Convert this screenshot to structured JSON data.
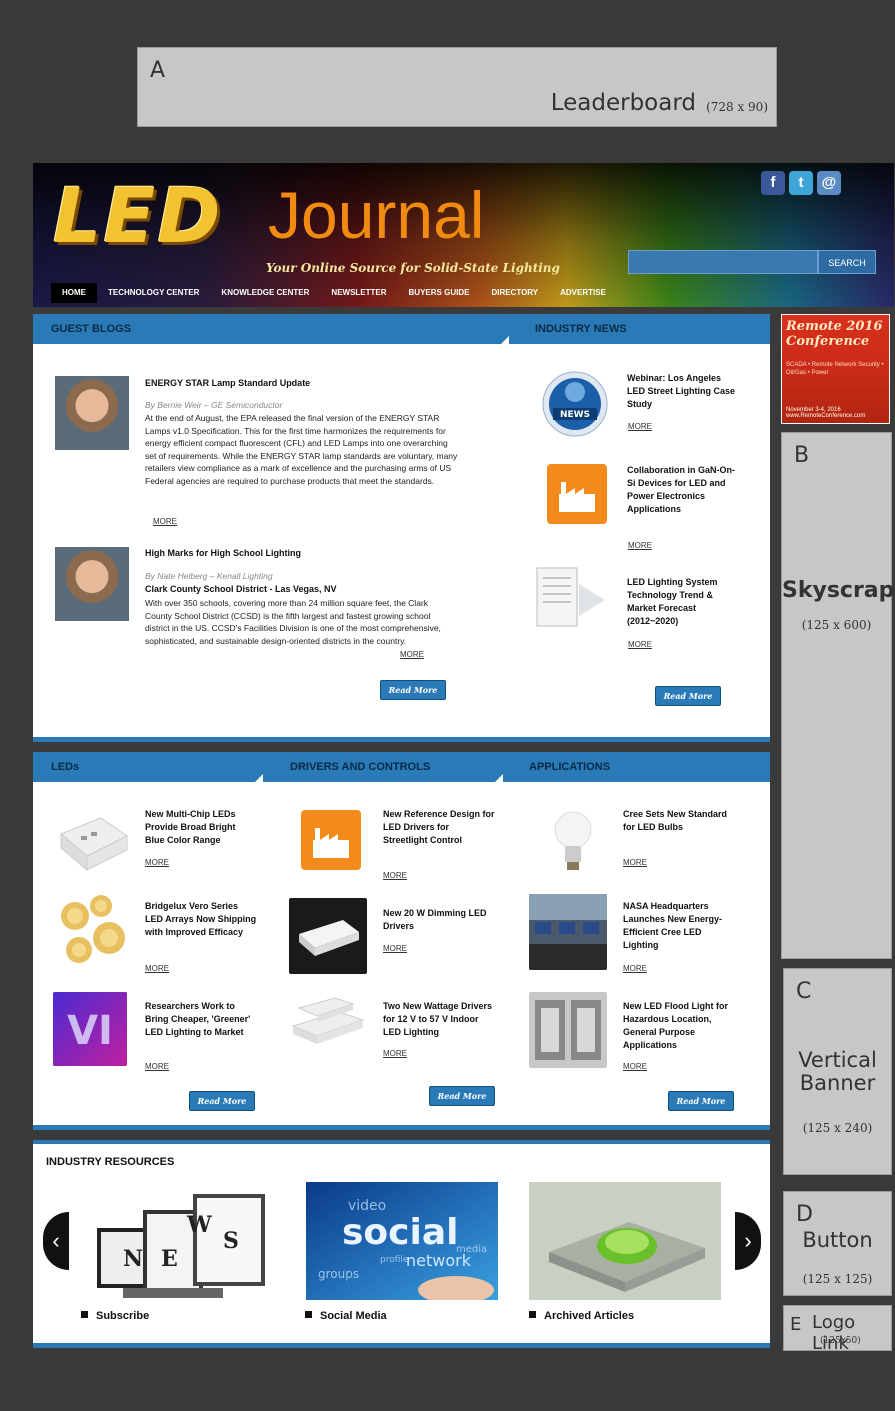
{
  "ads": {
    "leaderboard": {
      "letter": "A",
      "title": "Leaderboard",
      "size": "(728 x 90)"
    },
    "skyscraper": {
      "letter": "B",
      "title": "Skyscraper",
      "size": "(125 x 600)"
    },
    "vertical_banner": {
      "letter": "C",
      "title": "Vertical Banner",
      "size": "(125 x 240)"
    },
    "button": {
      "letter": "D",
      "title": "Button",
      "size": "(125 x 125)"
    },
    "logo_link": {
      "letter": "E",
      "title": "Logo Link",
      "size": "(125x50)"
    }
  },
  "header": {
    "logo_led": "LED",
    "logo_journal": "Journal",
    "tagline": "Your Online Source for Solid-State Lighting",
    "search_button": "SEARCH",
    "social": {
      "facebook": "f",
      "twitter": "t",
      "email": "@"
    },
    "nav": [
      "HOME",
      "TECHNOLOGY CENTER",
      "KNOWLEDGE CENTER",
      "NEWSLETTER",
      "BUYERS GUIDE",
      "DIRECTORY",
      "ADVERTISE"
    ]
  },
  "guest_blogs": {
    "heading": "GUEST BLOGS",
    "posts": [
      {
        "title": "ENERGY STAR Lamp Standard Update",
        "byline": "By Bernie Weir – GE Semiconductor",
        "text": "At the end of August, the EPA released the final version of the ENERGY STAR Lamps v1.0 Specification. This for the first time harmonizes the requirements for energy efficient compact fluorescent (CFL) and LED Lamps into one overarching set of requirements. While the ENERGY STAR lamp standards are voluntary, many retailers view compliance as a mark of excellence and the purchasing arms of US Federal agencies are required to purchase products that meet the standards.",
        "more": "MORE"
      },
      {
        "title": "High Marks for High School Lighting",
        "byline": "By Nate Helberg – Kenall Lighting",
        "subtitle": "Clark County School District - Las Vegas, NV",
        "text": "With over 350 schools, covering more than 24 million square feet, the Clark County School District (CCSD) is the fifth largest and fastest growing school district in the US. CCSD's Facilities Division is one of the most comprehensive, sophisticated, and sustainable design-oriented districts in the country.",
        "more": "MORE"
      }
    ],
    "read_more": "Read More"
  },
  "industry_news": {
    "heading": "INDUSTRY NEWS",
    "icon_label": "NEWS",
    "items": [
      {
        "title": "Webinar: Los Angeles LED Street Lighting Case Study",
        "more": "MORE"
      },
      {
        "title": "Collaboration in GaN-On-Si Devices for LED and Power Electronics Applications",
        "more": "MORE"
      },
      {
        "title": "LED Lighting System Technology Trend & Market Forecast (2012~2020)",
        "more": "MORE"
      }
    ],
    "read_more": "Read More"
  },
  "remote_ad": {
    "title": "Remote 2016 Conference",
    "subtitle": "SCADA • Remote Network Security • Oil/Gas • Power",
    "dates": "November 3-4, 2016 www.RemoteConference.com"
  },
  "sections": {
    "leds": {
      "heading": "LEDs",
      "items": [
        {
          "title": "New Multi-Chip LEDs Provide Broad Bright Blue Color Range",
          "more": "MORE"
        },
        {
          "title": "Bridgelux Vero Series LED Arrays Now Shipping with Improved Efficacy",
          "more": "MORE"
        },
        {
          "title": "Researchers Work to Bring Cheaper, 'Greener' LED Lighting to Market",
          "more": "MORE"
        }
      ],
      "read_more": "Read More"
    },
    "drivers": {
      "heading": "DRIVERS AND CONTROLS",
      "items": [
        {
          "title": "New Reference Design for LED Drivers for Streetlight Control",
          "more": "MORE"
        },
        {
          "title": "New 20 W Dimming LED Drivers",
          "more": "MORE"
        },
        {
          "title": "Two New Wattage Drivers for 12 V to 57 V Indoor LED Lighting",
          "more": "MORE"
        }
      ],
      "read_more": "Read More"
    },
    "applications": {
      "heading": "APPLICATIONS",
      "items": [
        {
          "title": "Cree Sets New Standard for LED Bulbs",
          "more": "MORE"
        },
        {
          "title": "NASA Headquarters Launches New Energy-Efficient Cree LED Lighting",
          "more": "MORE"
        },
        {
          "title": "New LED Flood Light for Hazardous Location, General Purpose Applications",
          "more": "MORE"
        }
      ],
      "read_more": "Read More"
    }
  },
  "resources": {
    "heading": "INDUSTRY RESOURCES",
    "items": [
      {
        "label": "Subscribe",
        "image_letters": [
          "N",
          "E",
          "W",
          "S"
        ]
      },
      {
        "label": "Social Media",
        "image_words": [
          "video",
          "social",
          "network",
          "groups",
          "media",
          "profile"
        ]
      },
      {
        "label": "Archived Articles"
      }
    ],
    "prev": "‹",
    "next": "›"
  }
}
